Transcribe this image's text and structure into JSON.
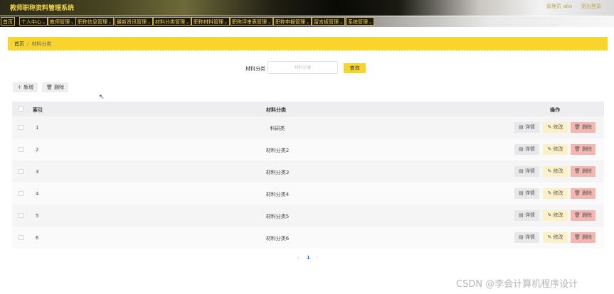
{
  "header": {
    "title": "教师职称资料管理系统",
    "admin_label": "管理员 abo",
    "logout_label": "退出登录"
  },
  "nav": [
    {
      "label": "首页",
      "has_dropdown": false
    },
    {
      "label": "个人中心",
      "has_dropdown": true
    },
    {
      "label": "教师管理",
      "has_dropdown": true
    },
    {
      "label": "职称信息管理",
      "has_dropdown": true
    },
    {
      "label": "最新资讯管理",
      "has_dropdown": true
    },
    {
      "label": "材料分类管理",
      "has_dropdown": true
    },
    {
      "label": "职称材料管理",
      "has_dropdown": true
    },
    {
      "label": "职称评审表管理",
      "has_dropdown": true
    },
    {
      "label": "职称申报管理",
      "has_dropdown": true
    },
    {
      "label": "留言板管理",
      "has_dropdown": true
    },
    {
      "label": "系统管理",
      "has_dropdown": true
    }
  ],
  "breadcrumb": {
    "home": "首页",
    "separator": "/",
    "current": "材料分类"
  },
  "search": {
    "label": "材料分类",
    "placeholder": "材料分类",
    "value": "",
    "button": "查询"
  },
  "toolbar": {
    "add_label": "新增",
    "delete_label": "删除"
  },
  "table": {
    "columns": [
      "索引",
      "材料分类",
      "操作"
    ],
    "rows": [
      {
        "index": "1",
        "category": "科研类"
      },
      {
        "index": "2",
        "category": "材料分类2"
      },
      {
        "index": "3",
        "category": "材料分类3"
      },
      {
        "index": "4",
        "category": "材料分类4"
      },
      {
        "index": "5",
        "category": "材料分类5"
      },
      {
        "index": "6",
        "category": "材料分类6"
      }
    ],
    "row_actions": {
      "detail": "详情",
      "edit": "修改",
      "delete": "删除"
    }
  },
  "pagination": {
    "prev": "‹",
    "current_page": "1",
    "next": "›"
  },
  "watermark": "CSDN @李会计算机程序设计",
  "colors": {
    "accent": "#f7d52c",
    "nav_text": "#f5d34b",
    "delete_btn": "#f4b6b0",
    "edit_btn": "#fbf0c8"
  }
}
